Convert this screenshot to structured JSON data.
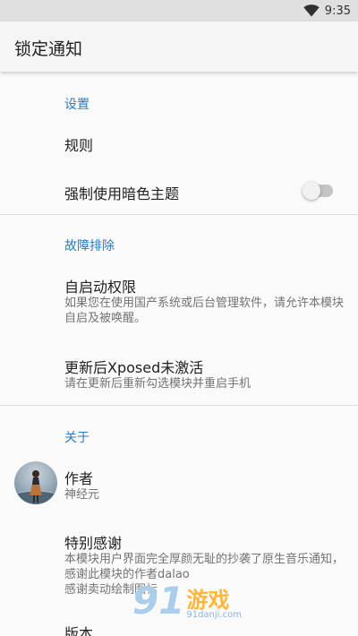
{
  "status_bar": {
    "time": "9:35",
    "wifi_icon": "wifi-icon"
  },
  "app_bar": {
    "title": "锁定通知"
  },
  "sections": {
    "settings": {
      "category": "设置",
      "rules": {
        "title": "规则"
      },
      "dark_theme": {
        "title": "强制使用暗色主题",
        "enabled": false
      }
    },
    "troubleshooting": {
      "category": "故障排除",
      "autostart": {
        "title": "自启动权限",
        "summary": "如果您在使用国产系统或后台管理软件，请允许本模块自启及被唤醒。"
      },
      "xposed": {
        "title": "更新后Xposed未激活",
        "summary": "请在更新后重新勾选模块并重启手机"
      }
    },
    "about": {
      "category": "关于",
      "author": {
        "title": "作者",
        "summary": "神经元"
      },
      "thanks": {
        "title": "特别感谢",
        "summary_line1": "本模块用户界面完全厚颜无耻的抄袭了原生音乐通知，感谢此模块的作者dalao",
        "summary_line2": "感谢卖动绘制图标"
      },
      "version": {
        "title": "版本"
      }
    }
  },
  "watermark": {
    "number": "91",
    "brand": "游戏",
    "domain": "91danji.com"
  },
  "colors": {
    "accent": "#2f79c2",
    "switch_track_off": "#c4c4c4"
  }
}
